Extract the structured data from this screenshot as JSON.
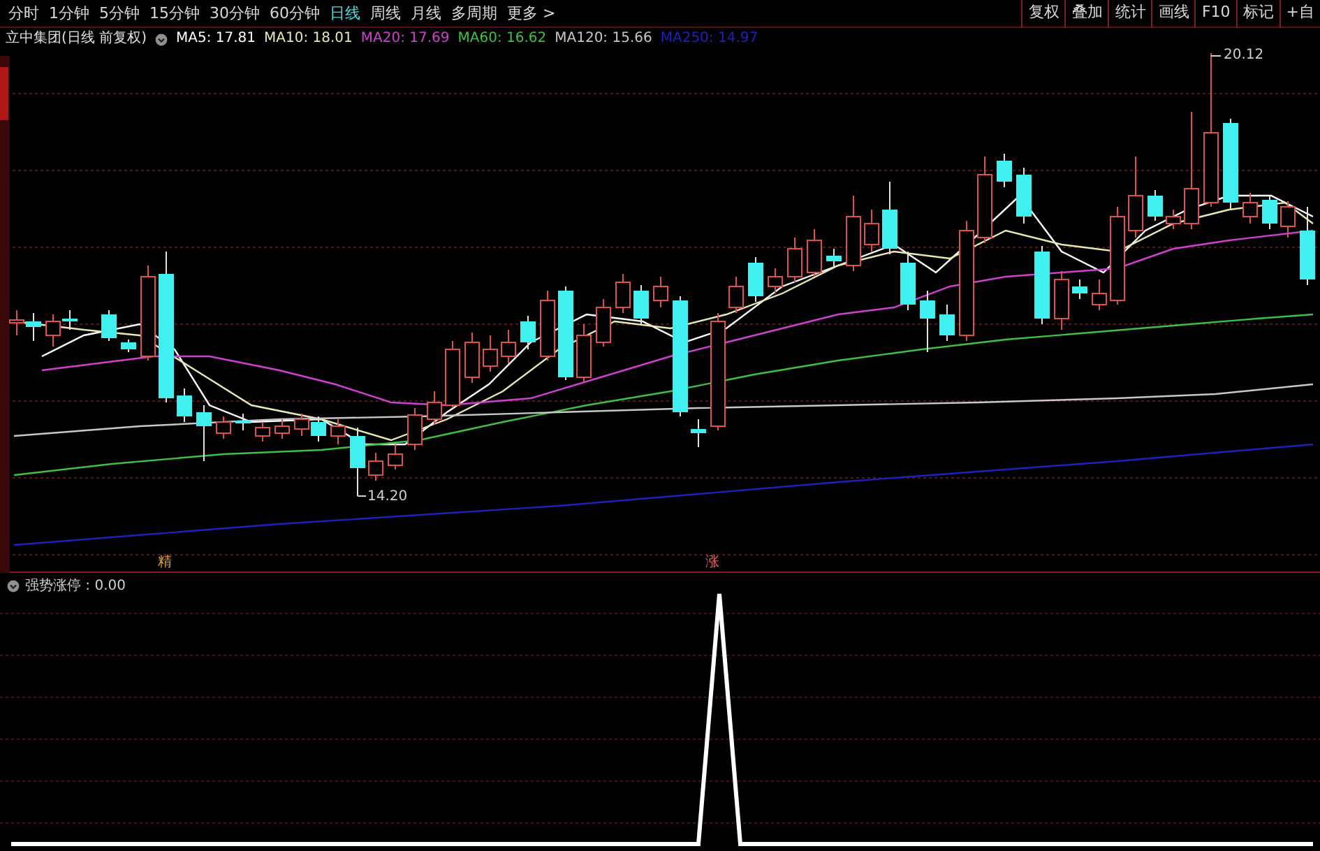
{
  "toolbar": {
    "periods": [
      {
        "label": "分时",
        "selected": false
      },
      {
        "label": "1分钟",
        "selected": false
      },
      {
        "label": "5分钟",
        "selected": false
      },
      {
        "label": "15分钟",
        "selected": false
      },
      {
        "label": "30分钟",
        "selected": false
      },
      {
        "label": "60分钟",
        "selected": false
      },
      {
        "label": "日线",
        "selected": true
      },
      {
        "label": "周线",
        "selected": false
      },
      {
        "label": "月线",
        "selected": false
      },
      {
        "label": "多周期",
        "selected": false
      },
      {
        "label": "更多 >",
        "selected": false
      }
    ],
    "tools": [
      "复权",
      "叠加",
      "统计",
      "画线",
      "F10",
      "标记",
      "+自"
    ]
  },
  "chart": {
    "title": "立中集团(日线 前复权)",
    "moving_averages": [
      {
        "label": "MA5: 17.81",
        "color": "#ffffff"
      },
      {
        "label": "MA10: 18.01",
        "color": "#e8e8b0"
      },
      {
        "label": "MA20: 17.69",
        "color": "#d040d0"
      },
      {
        "label": "MA60: 16.62",
        "color": "#40c040"
      },
      {
        "label": "MA120: 15.66",
        "color": "#c8c8c8"
      },
      {
        "label": "MA250: 14.97",
        "color": "#2020c0"
      }
    ],
    "high_label": "20.12",
    "low_label": "14.20",
    "signals": [
      {
        "label": "精"
      },
      {
        "label": "涨"
      }
    ]
  },
  "indicator": {
    "label": "强势涨停 : 0.00"
  }
}
